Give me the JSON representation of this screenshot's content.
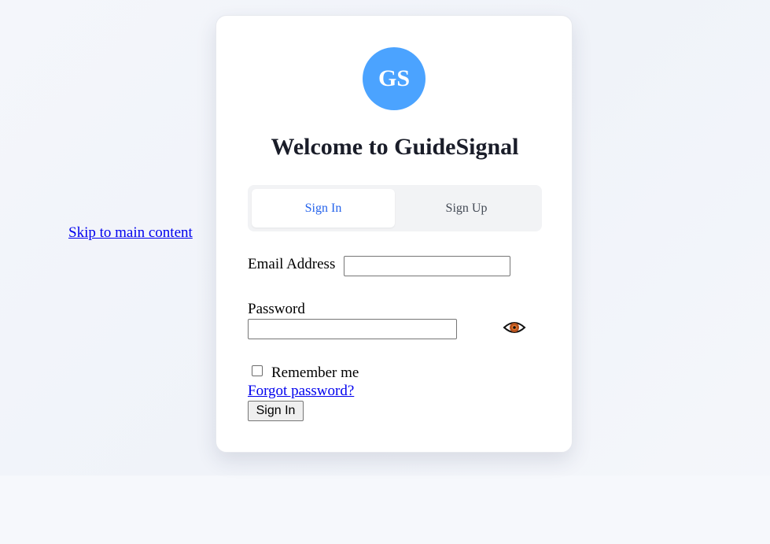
{
  "skip_link": "Skip to main content",
  "logo": {
    "initials": "GS",
    "color": "#4ba3ff"
  },
  "title": "Welcome to GuideSignal",
  "tabs": [
    {
      "label": "Sign In",
      "active": true
    },
    {
      "label": "Sign Up",
      "active": false
    }
  ],
  "form": {
    "email_label": "Email Address",
    "email_value": "",
    "password_label": "Password",
    "password_value": "",
    "toggle_icon": "eye-icon",
    "remember_label": "Remember me",
    "remember_checked": false,
    "forgot_label": "Forgot password?",
    "submit_label": "Sign In"
  },
  "colors": {
    "accent": "#2563eb",
    "link": "#0000ee"
  }
}
